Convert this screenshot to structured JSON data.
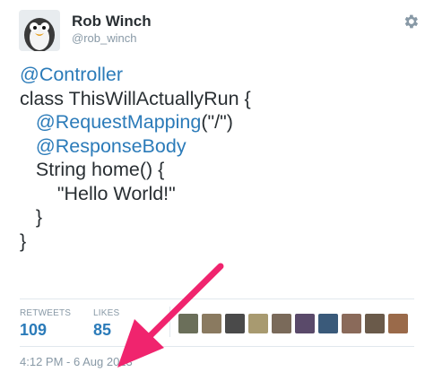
{
  "author": {
    "name": "Rob Winch",
    "handle": "@rob_winch",
    "avatar_icon": "penguin-avatar"
  },
  "header": {
    "settings_icon": "gear-icon"
  },
  "tweet": {
    "lines": [
      {
        "indent": "",
        "pre": "",
        "link": "@Controller",
        "post": ""
      },
      {
        "indent": "",
        "pre": "class ThisWillActuallyRun {",
        "link": "",
        "post": ""
      },
      {
        "indent": "   ",
        "pre": "",
        "link": "@RequestMapping",
        "post": "(\"/\")"
      },
      {
        "indent": "   ",
        "pre": "",
        "link": "@ResponseBody",
        "post": ""
      },
      {
        "indent": "   ",
        "pre": "String home() {",
        "link": "",
        "post": ""
      },
      {
        "indent": "       ",
        "pre": "\"Hello World!\"",
        "link": "",
        "post": ""
      },
      {
        "indent": "   ",
        "pre": "}",
        "link": "",
        "post": ""
      },
      {
        "indent": "",
        "pre": "}",
        "link": "",
        "post": ""
      }
    ]
  },
  "stats": {
    "retweets_label": "RETWEETS",
    "retweets_count": "109",
    "likes_label": "LIKES",
    "likes_count": "85"
  },
  "likers": [
    {
      "color": "#6b6f5a"
    },
    {
      "color": "#8a7a60"
    },
    {
      "color": "#4a4a4a"
    },
    {
      "color": "#a89a70"
    },
    {
      "color": "#7a6a5a"
    },
    {
      "color": "#5a4a6a"
    },
    {
      "color": "#3a5a7a"
    },
    {
      "color": "#8a6a5a"
    },
    {
      "color": "#6a5a4a"
    },
    {
      "color": "#9a6a4a"
    }
  ],
  "timestamp": "4:12 PM - 6 Aug 2013",
  "colors": {
    "link": "#2b7bb9",
    "meta": "#8899a6",
    "arrow": "#f0246e"
  }
}
